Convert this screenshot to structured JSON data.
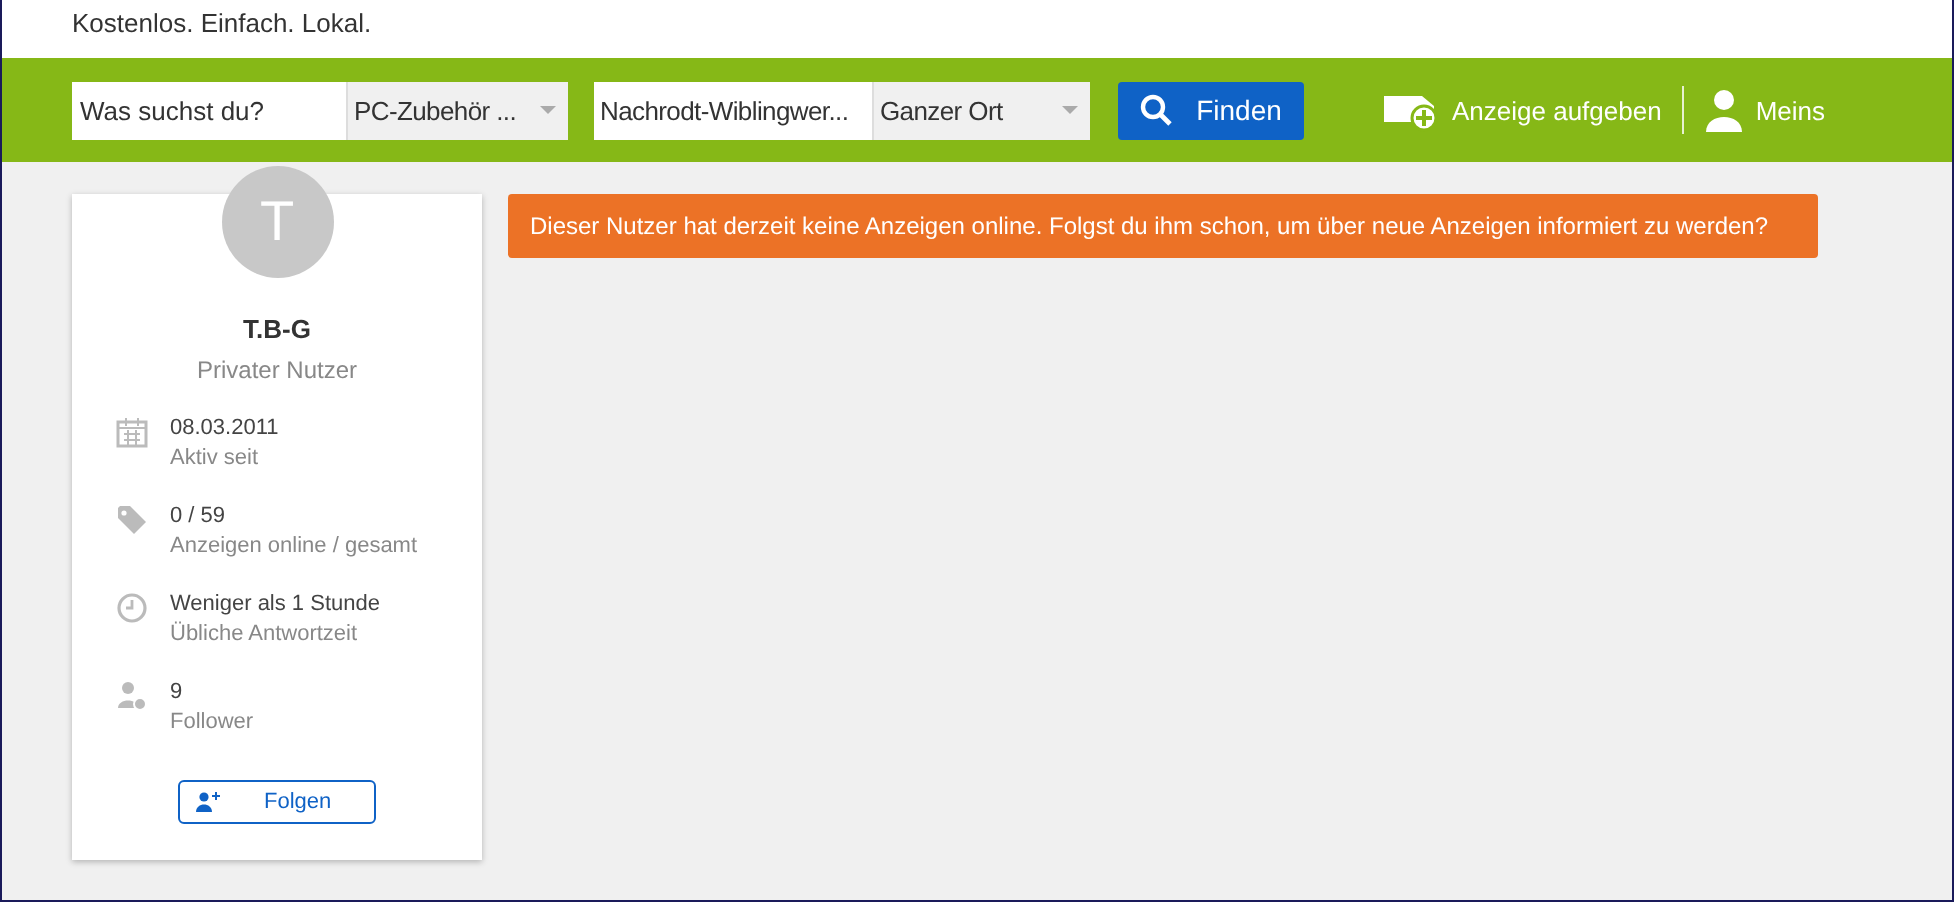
{
  "header": {
    "tagline": "Kostenlos. Einfach. Lokal."
  },
  "search": {
    "query_placeholder": "Was suchst du?",
    "category": "PC-Zubehör ...",
    "location": "Nachrodt-Wiblingwer...",
    "radius": "Ganzer Ort",
    "button": "Finden"
  },
  "nav": [
    {
      "kind": "post",
      "label": "Anzeige aufgeben"
    },
    {
      "kind": "user",
      "label": "Meins"
    }
  ],
  "profile": {
    "avatar_letter": "T",
    "name": "T.B-G",
    "type": "Privater Nutzer",
    "stats": [
      {
        "kind": "calendar",
        "value": "08.03.2011",
        "label": "Aktiv seit"
      },
      {
        "kind": "tag",
        "value": "0 / 59",
        "label": "Anzeigen online / gesamt"
      },
      {
        "kind": "clock",
        "value": "Weniger als 1 Stunde",
        "label": "Übliche Antwortzeit"
      },
      {
        "kind": "followers",
        "value": "9",
        "label": "Follower"
      }
    ],
    "follow_button": "Folgen"
  },
  "notice": "Dieser Nutzer hat derzeit keine Anzeigen online. Folgst du ihm schon, um über neue Anzeigen informiert zu werden?"
}
